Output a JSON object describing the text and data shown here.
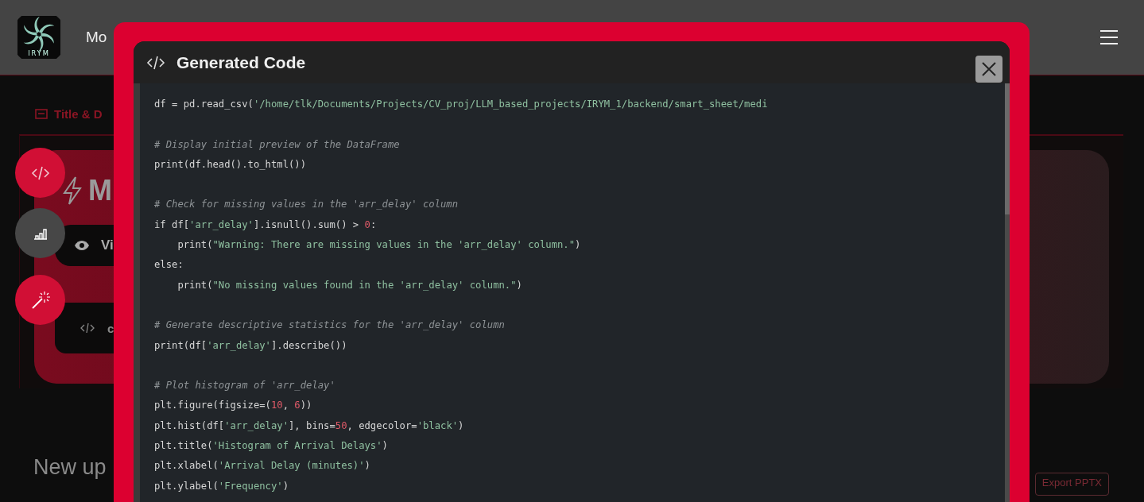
{
  "header": {
    "logo_text": "IRYM",
    "brand_text": "Mo"
  },
  "tab_label": "Title & D",
  "hero": {
    "title": "M",
    "view_label": "Vi",
    "code_label": "c"
  },
  "fab": [
    {
      "kind": "code",
      "active": true
    },
    {
      "kind": "chart",
      "active": false
    },
    {
      "kind": "magic",
      "active": true
    }
  ],
  "section_title": "New up",
  "export_button": "Export PPTX",
  "modal": {
    "title": "Generated Code",
    "lines": [
      {
        "kind": "code",
        "tokens": [
          {
            "kind": "plain",
            "text": "df = pd.read_csv("
          },
          {
            "kind": "string",
            "text": "'/home/tlk/Documents/Projects/CV_proj/LLM_based_projects/IRYM_1/backend/smart_sheet/medi"
          }
        ]
      },
      {
        "kind": "blank"
      },
      {
        "kind": "code",
        "tokens": [
          {
            "kind": "comment",
            "text": "# Display initial preview of the DataFrame"
          }
        ]
      },
      {
        "kind": "code",
        "tokens": [
          {
            "kind": "plain",
            "text": "print(df.head().to_html())"
          }
        ]
      },
      {
        "kind": "blank"
      },
      {
        "kind": "code",
        "tokens": [
          {
            "kind": "comment",
            "text": "# Check for missing values in the 'arr_delay' column"
          }
        ]
      },
      {
        "kind": "code",
        "tokens": [
          {
            "kind": "plain",
            "text": "if df["
          },
          {
            "kind": "string",
            "text": "'arr_delay'"
          },
          {
            "kind": "plain",
            "text": "].isnull().sum() > "
          },
          {
            "kind": "number",
            "text": "0"
          },
          {
            "kind": "plain",
            "text": ":"
          }
        ]
      },
      {
        "kind": "code",
        "tokens": [
          {
            "kind": "plain",
            "text": "    print("
          },
          {
            "kind": "string",
            "text": "\"Warning: There are missing values in the 'arr_delay' column.\""
          },
          {
            "kind": "plain",
            "text": ")"
          }
        ]
      },
      {
        "kind": "code",
        "tokens": [
          {
            "kind": "plain",
            "text": "else:"
          }
        ]
      },
      {
        "kind": "code",
        "tokens": [
          {
            "kind": "plain",
            "text": "    print("
          },
          {
            "kind": "string",
            "text": "\"No missing values found in the 'arr_delay' column.\""
          },
          {
            "kind": "plain",
            "text": ")"
          }
        ]
      },
      {
        "kind": "blank"
      },
      {
        "kind": "code",
        "tokens": [
          {
            "kind": "comment",
            "text": "# Generate descriptive statistics for the 'arr_delay' column"
          }
        ]
      },
      {
        "kind": "code",
        "tokens": [
          {
            "kind": "plain",
            "text": "print(df["
          },
          {
            "kind": "string",
            "text": "'arr_delay'"
          },
          {
            "kind": "plain",
            "text": "].describe())"
          }
        ]
      },
      {
        "kind": "blank"
      },
      {
        "kind": "code",
        "tokens": [
          {
            "kind": "comment",
            "text": "# Plot histogram of 'arr_delay'"
          }
        ]
      },
      {
        "kind": "code",
        "tokens": [
          {
            "kind": "plain",
            "text": "plt.figure(figsize=("
          },
          {
            "kind": "number",
            "text": "10"
          },
          {
            "kind": "plain",
            "text": ", "
          },
          {
            "kind": "number",
            "text": "6"
          },
          {
            "kind": "plain",
            "text": "))"
          }
        ]
      },
      {
        "kind": "code",
        "tokens": [
          {
            "kind": "plain",
            "text": "plt.hist(df["
          },
          {
            "kind": "string",
            "text": "'arr_delay'"
          },
          {
            "kind": "plain",
            "text": "], bins="
          },
          {
            "kind": "number",
            "text": "50"
          },
          {
            "kind": "plain",
            "text": ", edgecolor="
          },
          {
            "kind": "string",
            "text": "'black'"
          },
          {
            "kind": "plain",
            "text": ")"
          }
        ]
      },
      {
        "kind": "code",
        "tokens": [
          {
            "kind": "plain",
            "text": "plt.title("
          },
          {
            "kind": "string",
            "text": "'Histogram of Arrival Delays'"
          },
          {
            "kind": "plain",
            "text": ")"
          }
        ]
      },
      {
        "kind": "code",
        "tokens": [
          {
            "kind": "plain",
            "text": "plt.xlabel("
          },
          {
            "kind": "string",
            "text": "'Arrival Delay (minutes)'"
          },
          {
            "kind": "plain",
            "text": ")"
          }
        ]
      },
      {
        "kind": "code",
        "tokens": [
          {
            "kind": "plain",
            "text": "plt.ylabel("
          },
          {
            "kind": "string",
            "text": "'Frequency'"
          },
          {
            "kind": "plain",
            "text": ")"
          }
        ]
      }
    ]
  }
}
